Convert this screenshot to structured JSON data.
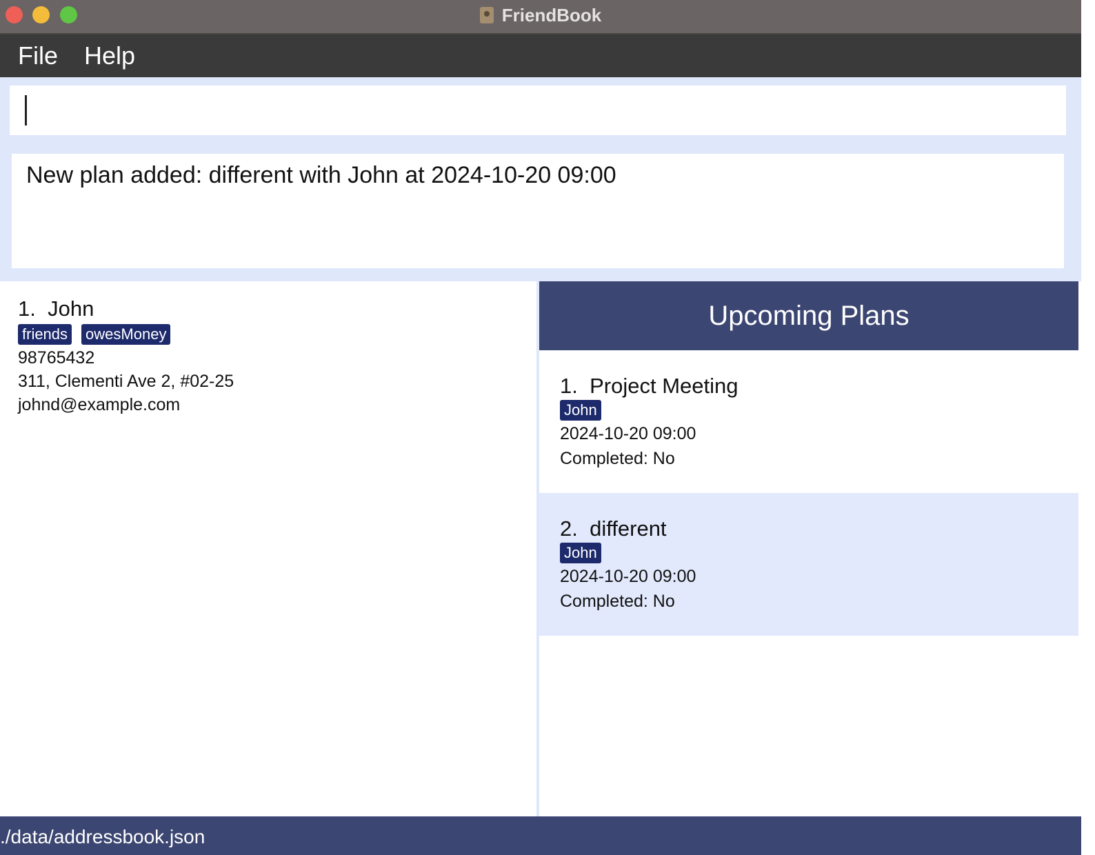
{
  "window": {
    "title": "FriendBook",
    "controls": [
      "close",
      "minimize",
      "maximize"
    ],
    "colors": {
      "close": "#ee5f57",
      "minimize": "#f3bd3b",
      "maximize": "#5fc646"
    }
  },
  "menu": {
    "items": [
      "File",
      "Help"
    ]
  },
  "command": {
    "value": "",
    "placeholder": ""
  },
  "result": {
    "text": "New plan added: different with John at 2024-10-20 09:00"
  },
  "persons": [
    {
      "index": "1.",
      "name": "John",
      "tags": [
        "friends",
        "owesMoney"
      ],
      "phone": "98765432",
      "address": "311, Clementi Ave 2, #02-25",
      "email": "johnd@example.com"
    }
  ],
  "plans": {
    "header": "Upcoming Plans",
    "items": [
      {
        "index": "1.",
        "name": "Project Meeting",
        "tags": [
          "John"
        ],
        "datetime": "2024-10-20 09:00",
        "completed": "Completed: No"
      },
      {
        "index": "2.",
        "name": "different",
        "tags": [
          "John"
        ],
        "datetime": "2024-10-20 09:00",
        "completed": "Completed: No"
      }
    ]
  },
  "status": {
    "path": "./data/addressbook.json"
  },
  "colors": {
    "accent": "#3c4672",
    "tag": "#1d2a6b",
    "panel_bg": "#dfe7fb",
    "selected_row": "#e2e9fc"
  }
}
